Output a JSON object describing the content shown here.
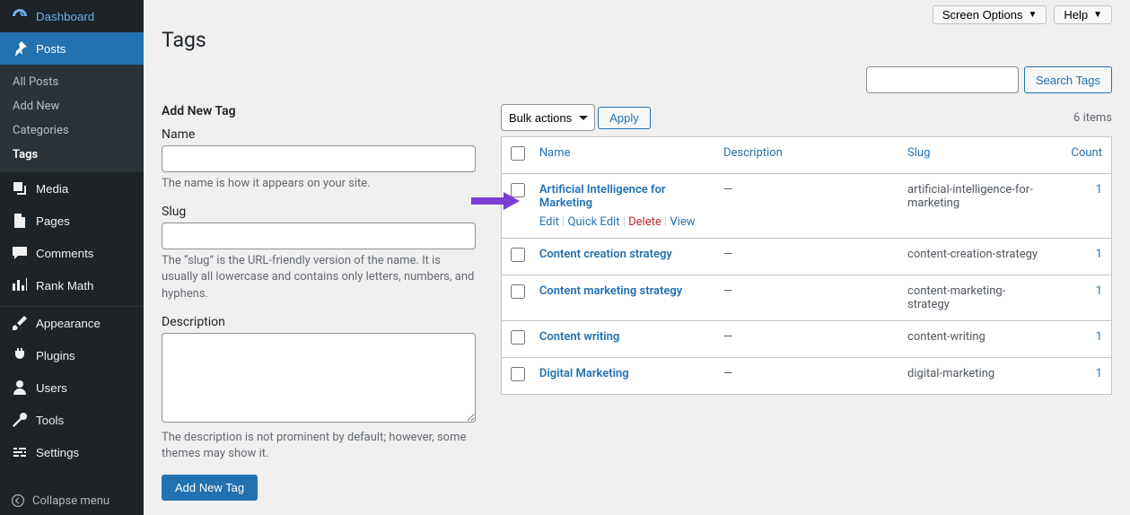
{
  "topbar": {
    "screen_options": "Screen Options",
    "help": "Help"
  },
  "page": {
    "title": "Tags"
  },
  "sidebar": {
    "dashboard": "Dashboard",
    "posts": "Posts",
    "posts_sub": {
      "all": "All Posts",
      "add": "Add New",
      "categories": "Categories",
      "tags": "Tags"
    },
    "media": "Media",
    "pages": "Pages",
    "comments": "Comments",
    "rankmath": "Rank Math",
    "appearance": "Appearance",
    "plugins": "Plugins",
    "users": "Users",
    "tools": "Tools",
    "settings": "Settings",
    "collapse": "Collapse menu"
  },
  "form": {
    "heading": "Add New Tag",
    "name_label": "Name",
    "name_help": "The name is how it appears on your site.",
    "slug_label": "Slug",
    "slug_help": "The “slug” is the URL-friendly version of the name. It is usually all lowercase and contains only letters, numbers, and hyphens.",
    "desc_label": "Description",
    "desc_help": "The description is not prominent by default; however, some themes may show it.",
    "submit": "Add New Tag"
  },
  "search": {
    "button": "Search Tags",
    "value": ""
  },
  "bulk": {
    "selected": "Bulk actions",
    "apply": "Apply"
  },
  "table": {
    "count_text": "6 items",
    "headers": {
      "name": "Name",
      "description": "Description",
      "slug": "Slug",
      "count": "Count"
    },
    "row_actions": {
      "edit": "Edit",
      "quick_edit": "Quick Edit",
      "delete": "Delete",
      "view": "View"
    },
    "rows": [
      {
        "name": "Artificial Intelligence for Marketing",
        "description": "—",
        "slug": "artificial-intelligence-for-marketing",
        "count": "1",
        "show_actions": true
      },
      {
        "name": "Content creation strategy",
        "description": "—",
        "slug": "content-creation-strategy",
        "count": "1",
        "show_actions": false
      },
      {
        "name": "Content marketing strategy",
        "description": "—",
        "slug": "content-marketing-strategy",
        "count": "1",
        "show_actions": false
      },
      {
        "name": "Content writing",
        "description": "—",
        "slug": "content-writing",
        "count": "1",
        "show_actions": false
      },
      {
        "name": "Digital Marketing",
        "description": "—",
        "slug": "digital-marketing",
        "count": "1",
        "show_actions": false
      }
    ]
  },
  "colors": {
    "purple": "#7b3fd1"
  }
}
